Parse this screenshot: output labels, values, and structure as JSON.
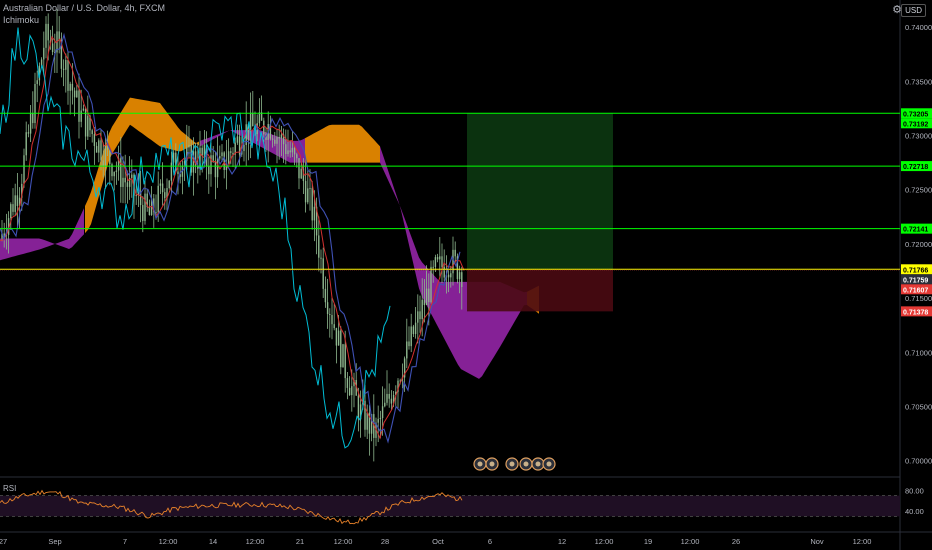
{
  "header": {
    "title": "Australian Dollar / U.S. Dollar, 4h, FXCM",
    "indicator": "Ichimoku",
    "currency_button": "USD"
  },
  "rsi_label": "RSI",
  "colors": {
    "background": "#000000",
    "candle": "#8fb88f",
    "tenkan": "#00bcd4",
    "kijun": "#d32f2f",
    "chikou": "#3f51b5",
    "cloud_bull": "#ff9800",
    "cloud_bear": "#9c27b0",
    "hline_green": "#00ff00",
    "hline_yellow": "#ffff00",
    "rsi_line": "#e8822a",
    "rsi_band": "#1f0f24"
  },
  "chart_data": {
    "type": "candlestick",
    "y_axis_ticks": [
      "0.74000",
      "0.73500",
      "0.73000",
      "0.72500",
      "0.72000",
      "0.71500",
      "0.71000",
      "0.70500",
      "0.70000"
    ],
    "ylim": [
      0.6985,
      0.7425
    ],
    "x_axis_ticks": [
      "27",
      "Sep",
      "7",
      "12:00",
      "14",
      "12:00",
      "21",
      "12:00",
      "28",
      "Oct",
      "6",
      "12",
      "12:00",
      "19",
      "12:00",
      "26",
      "Nov",
      "12:00"
    ],
    "price_labels": [
      {
        "value": 0.73205,
        "text": "0.73205",
        "color": "#00ff00"
      },
      {
        "value": 0.73192,
        "text": "0.73192",
        "color": "#00ff00"
      },
      {
        "value": 0.72718,
        "text": "0.72718",
        "color": "#00ff00"
      },
      {
        "value": 0.72141,
        "text": "0.72141",
        "color": "#00ff00"
      },
      {
        "value": 0.71766,
        "text": "0.71766",
        "color": "#ffff00"
      },
      {
        "value": 0.71759,
        "text": "0.71759",
        "color": "#2a2e39"
      },
      {
        "value": 0.71607,
        "text": "0.71607",
        "color": "#e53935"
      },
      {
        "value": 0.71378,
        "text": "0.71378",
        "color": "#e53935"
      }
    ],
    "horizontal_lines": [
      {
        "value": 0.73205,
        "color": "#00ff00"
      },
      {
        "value": 0.72718,
        "color": "#00ff00"
      },
      {
        "value": 0.72141,
        "color": "#00ff00"
      },
      {
        "value": 0.71766,
        "color": "#ffff00"
      }
    ],
    "position_box": {
      "entry": 0.71766,
      "target": 0.73205,
      "stop": 0.71378
    },
    "rsi": {
      "ticks": [
        "80.00",
        "40.00"
      ],
      "upper": 70,
      "lower": 30
    }
  }
}
